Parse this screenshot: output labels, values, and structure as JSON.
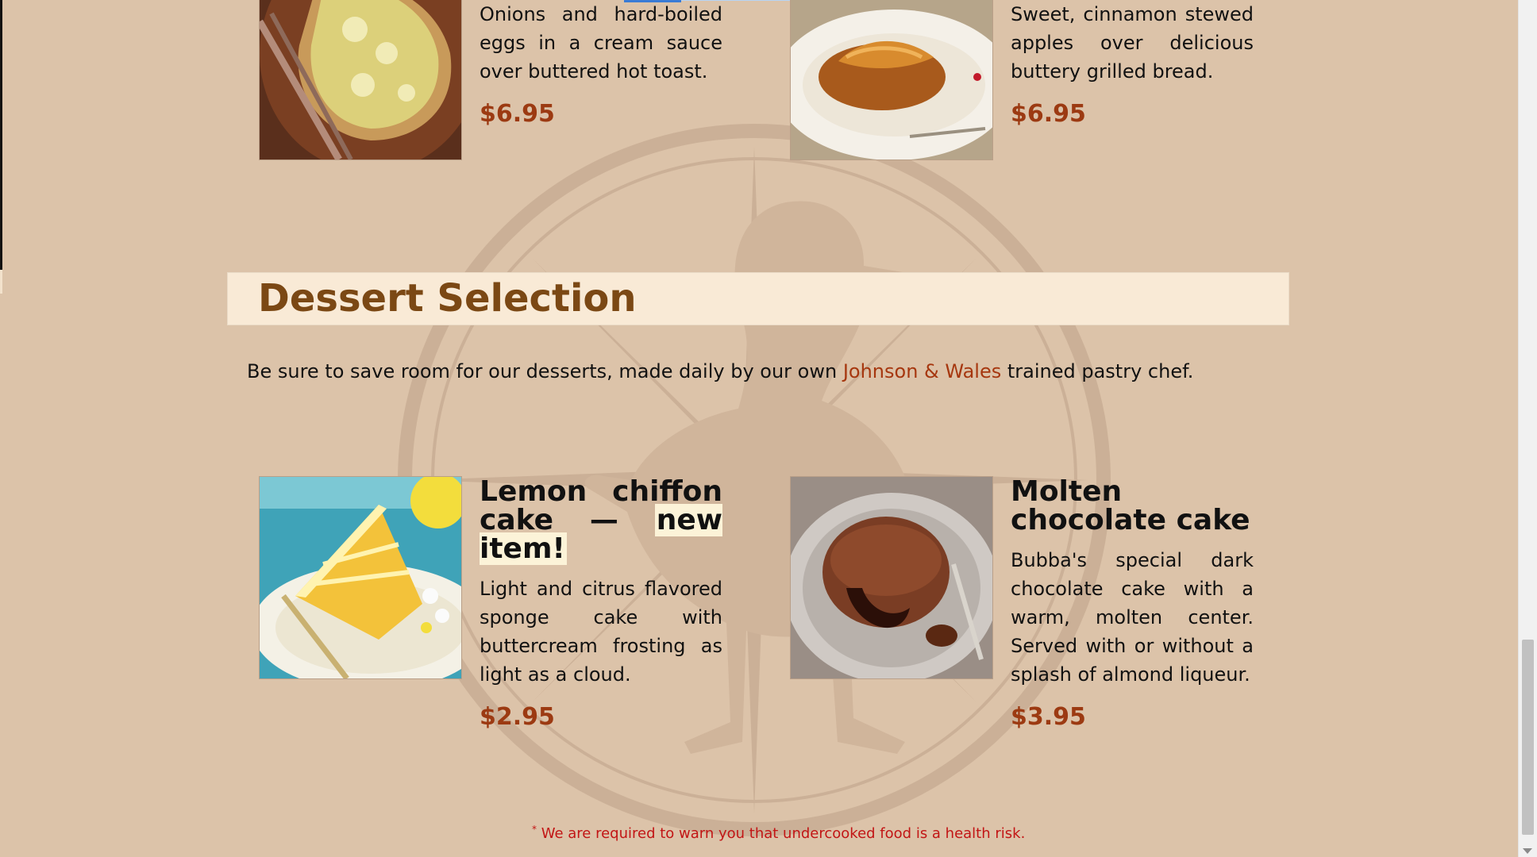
{
  "top_items": [
    {
      "description": "Onions and hard-boiled eggs in a cream sauce over buttered hot toast.",
      "price": "$6.95"
    },
    {
      "description": "Sweet, cinnamon stewed apples over delicious buttery grilled bread.",
      "price": "$6.95"
    }
  ],
  "dessert_section": {
    "title": "Dessert Selection",
    "intro_before": "Be sure to save room for our desserts, made daily by our own ",
    "intro_link": "Johnson & Wales",
    "intro_after": " trained pastry chef.",
    "items": [
      {
        "title": "Lemon chiffon cake — ",
        "badge": "new item!",
        "description": "Light and citrus flavored sponge cake with buttercream frosting as light as a cloud.",
        "price": "$2.95"
      },
      {
        "title": "Molten chocolate cake",
        "description": "Bubba's special dark chocolate cake with a warm, molten center. Served with or without a splash of almond liqueur.",
        "price": "$3.95"
      }
    ]
  },
  "footnote": {
    "marker": "*",
    "text": " We are required to warn you that undercooked food is a health risk."
  },
  "colors": {
    "background": "#dcc3a9",
    "section_header_bg": "#f9ead6",
    "section_title": "#7b4814",
    "price": "#9c3a12",
    "link": "#a6370f",
    "warning": "#c21515"
  },
  "icons": {
    "watermark": "goose-compass-logo"
  }
}
